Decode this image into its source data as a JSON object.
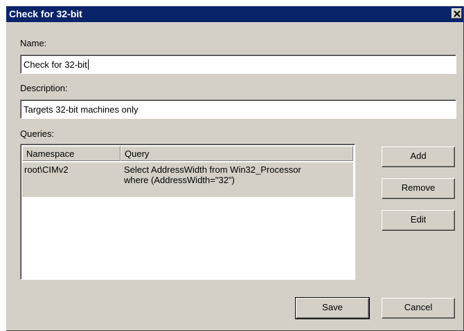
{
  "window": {
    "title": "Check for 32-bit",
    "close_icon": "close-icon"
  },
  "name_field": {
    "label": "Name:",
    "value": "Check for 32-bit"
  },
  "description_field": {
    "label": "Description:",
    "value": "Targets 32-bit machines only"
  },
  "queries": {
    "label": "Queries:",
    "columns": [
      "Namespace",
      "Query"
    ],
    "rows": [
      {
        "namespace": "root\\CIMv2",
        "query_line1": "Select AddressWidth from Win32_Processor",
        "query_line2": "where (AddressWidth=\"32\")"
      }
    ]
  },
  "buttons": {
    "add": "Add",
    "remove": "Remove",
    "edit": "Edit",
    "save": "Save",
    "cancel": "Cancel"
  },
  "colors": {
    "titlebar": "#0a246a",
    "dialog_bg": "#d4d0c8",
    "selected_row": "#d4d0c8"
  }
}
